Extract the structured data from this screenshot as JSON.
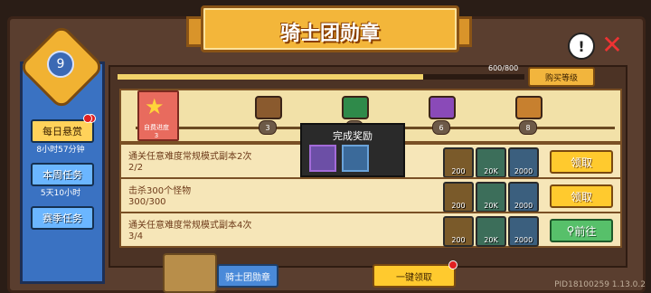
{
  "title": "骑士团勋章",
  "level": "9",
  "sidebar": {
    "tabs": [
      {
        "label": "每日悬赏",
        "sub": "8小时57分钟",
        "badge": "!"
      },
      {
        "label": "本周任务",
        "sub": "5天10小时"
      },
      {
        "label": "赛季任务"
      }
    ]
  },
  "progress": {
    "text": "600/800",
    "fraction": 0.75
  },
  "buy_level_label": "购买等级",
  "reward_track": {
    "trophy_label": "自费进度",
    "trophy_count": "3",
    "nodes": [
      "3",
      "4",
      "5",
      "6",
      "8"
    ],
    "chest_colors": [
      "#8a5a2e",
      "#2f8a4a",
      "#8a4ab8",
      "#c7802f"
    ]
  },
  "tasks": [
    {
      "title": "通关任意难度常规模式副本2次",
      "progress": "2/2",
      "rewards": [
        "200",
        "20K",
        "2000"
      ],
      "action": "领取"
    },
    {
      "title": "击杀300个怪物",
      "progress": "300/300",
      "rewards": [
        "200",
        "20K",
        "2000"
      ],
      "action": "领取"
    },
    {
      "title": "通关任意难度常规模式副本4次",
      "progress": "3/4",
      "rewards": [
        "200",
        "20K",
        "2000"
      ],
      "action": "前往"
    }
  ],
  "popup": {
    "title": "完成奖励"
  },
  "bottom": {
    "medal_label": "骑士团勋章",
    "claim_all_label": "一键领取"
  },
  "pid": "PID18100259 1.13.0.2"
}
